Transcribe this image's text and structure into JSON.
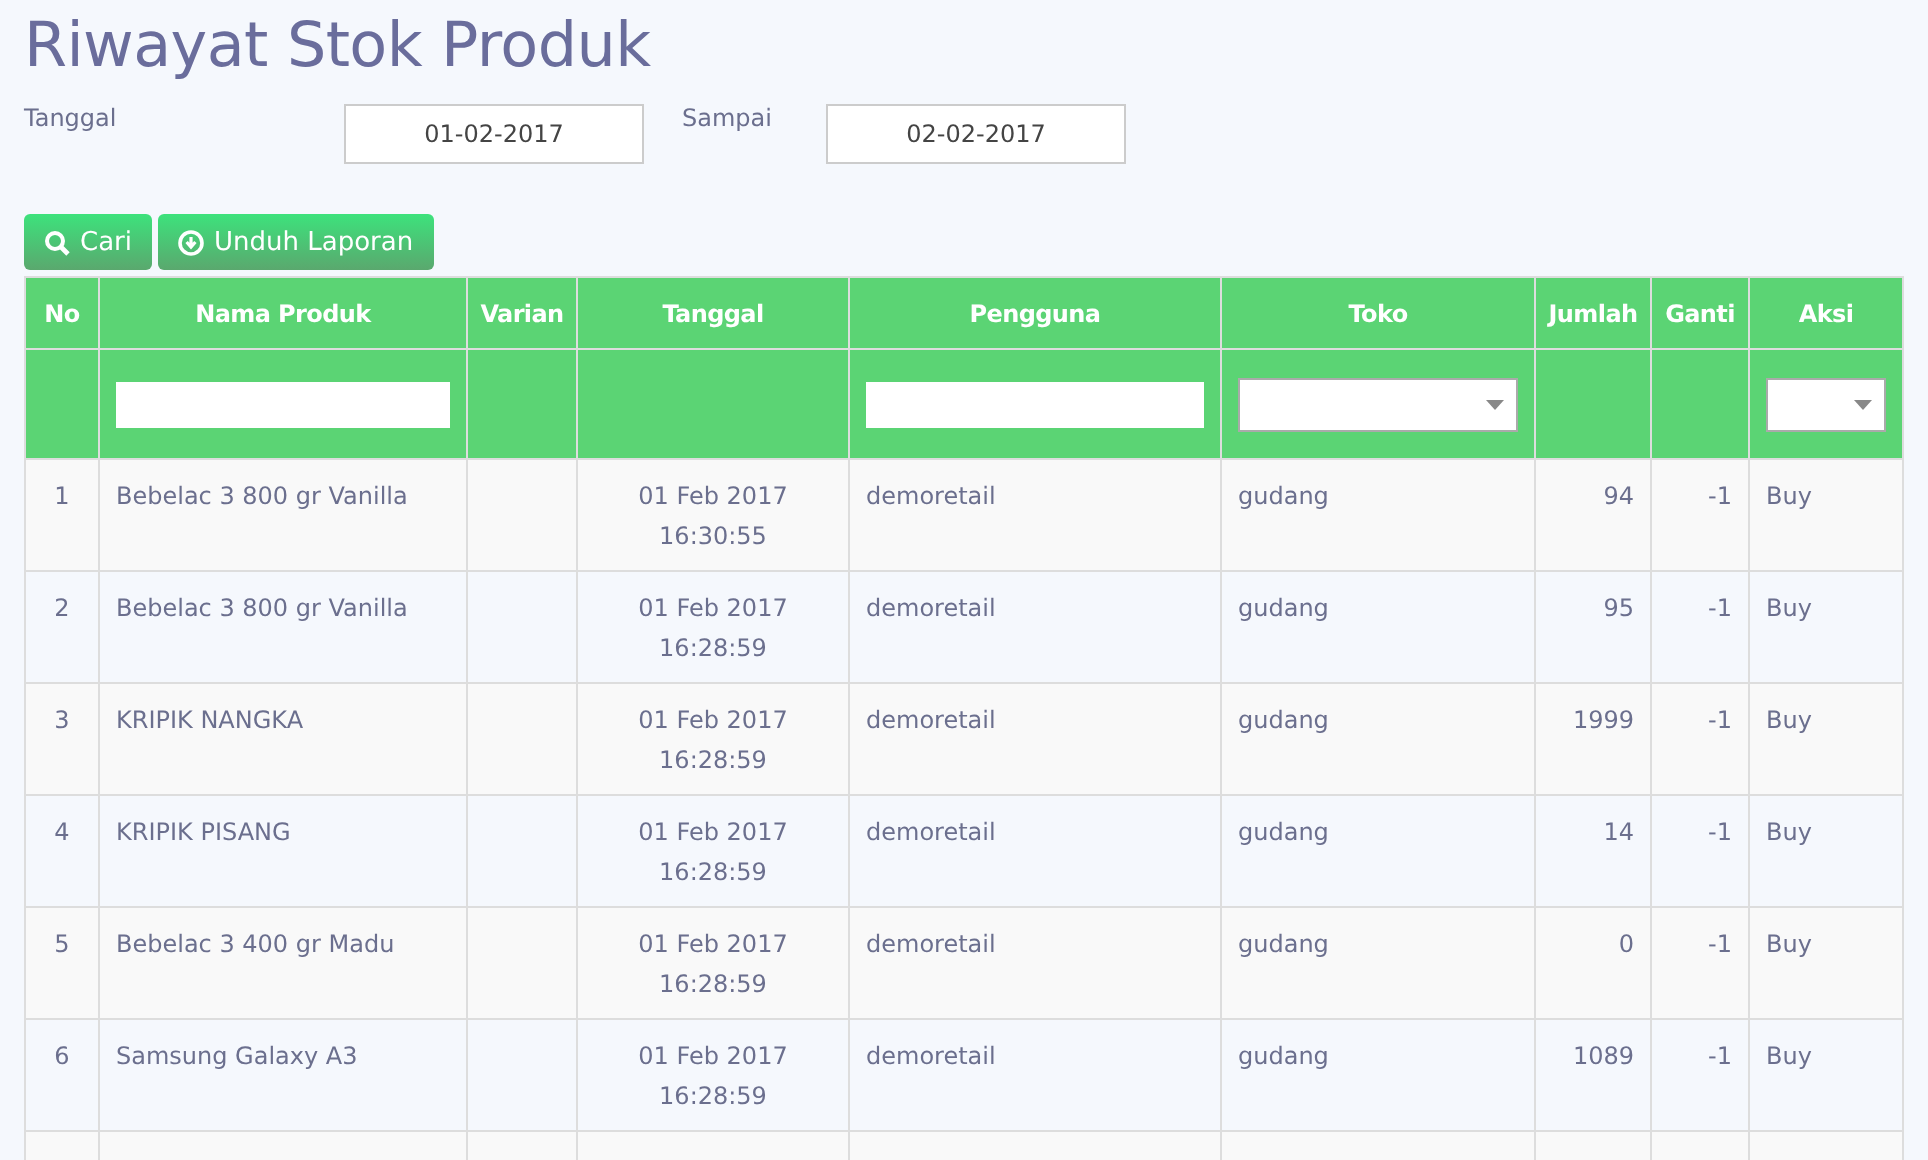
{
  "title": "Riwayat Stok Produk",
  "date_filter": {
    "from_label": "Tanggal",
    "from_value": "01-02-2017",
    "to_label": "Sampai",
    "to_value": "02-02-2017"
  },
  "buttons": [
    {
      "label": "Cari",
      "kind": "search"
    },
    {
      "label": "Unduh Laporan",
      "kind": "download"
    }
  ],
  "table": {
    "columns": [
      {
        "label": "No"
      },
      {
        "label": "Nama Produk",
        "kind": "text_filter"
      },
      {
        "label": "Varian"
      },
      {
        "label": "Tanggal"
      },
      {
        "label": "Pengguna",
        "kind": "text_filter"
      },
      {
        "label": "Toko",
        "kind": "select_filter"
      },
      {
        "label": "Jumlah"
      },
      {
        "label": "Ganti"
      },
      {
        "label": "Aksi",
        "kind": "select_filter"
      }
    ],
    "rows": [
      {
        "no": "1",
        "product": "Bebelac 3 800 gr Vanilla",
        "date": "01 Feb 2017",
        "time": "16:30:55",
        "user": "demoretail",
        "store": "gudang",
        "qty": "94",
        "change": "-1",
        "action": "Buy"
      },
      {
        "no": "2",
        "product": "Bebelac 3 800 gr Vanilla",
        "date": "01 Feb 2017",
        "time": "16:28:59",
        "user": "demoretail",
        "store": "gudang",
        "qty": "95",
        "change": "-1",
        "action": "Buy"
      },
      {
        "no": "3",
        "product": "KRIPIK NANGKA",
        "date": "01 Feb 2017",
        "time": "16:28:59",
        "user": "demoretail",
        "store": "gudang",
        "qty": "1999",
        "change": "-1",
        "action": "Buy"
      },
      {
        "no": "4",
        "product": "KRIPIK PISANG",
        "date": "01 Feb 2017",
        "time": "16:28:59",
        "user": "demoretail",
        "store": "gudang",
        "qty": "14",
        "change": "-1",
        "action": "Buy"
      },
      {
        "no": "5",
        "product": "Bebelac 3 400 gr Madu",
        "date": "01 Feb 2017",
        "time": "16:28:59",
        "user": "demoretail",
        "store": "gudang",
        "qty": "0",
        "change": "-1",
        "action": "Buy"
      },
      {
        "no": "6",
        "product": "Samsung Galaxy A3",
        "date": "01 Feb 2017",
        "time": "16:28:59",
        "user": "demoretail",
        "store": "gudang",
        "qty": "1089",
        "change": "-1",
        "action": "Buy"
      }
    ]
  }
}
